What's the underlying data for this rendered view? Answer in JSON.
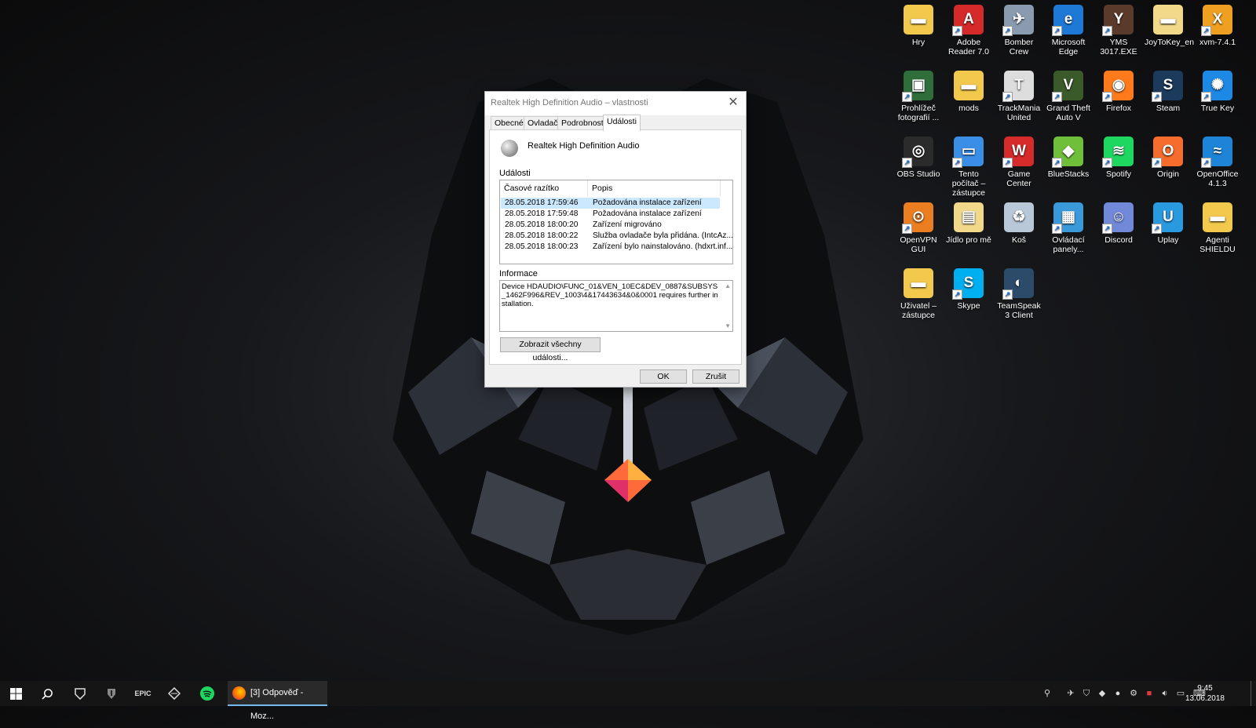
{
  "dialog": {
    "title": "Realtek High Definition Audio – vlastnosti",
    "tabs": [
      "Obecné",
      "Ovladač",
      "Podrobnosti",
      "Události"
    ],
    "active_tab": "Události",
    "device_name": "Realtek High Definition Audio",
    "events_label": "Události",
    "columns": [
      "Časové razítko",
      "Popis"
    ],
    "events": [
      {
        "time": "28.05.2018 17:59:46",
        "desc": "Požadována instalace zařízení"
      },
      {
        "time": "28.05.2018 17:59:48",
        "desc": "Požadována instalace zařízení"
      },
      {
        "time": "28.05.2018 18:00:20",
        "desc": "Zařízení migrováno"
      },
      {
        "time": "28.05.2018 18:00:22",
        "desc": "Služba ovladače byla přidána. (IntcAz..."
      },
      {
        "time": "28.05.2018 18:00:23",
        "desc": "Zařízení bylo nainstalováno. (hdxrt.inf..."
      }
    ],
    "info_label": "Informace",
    "info_text": "Device HDAUDIO\\FUNC_01&VEN_10EC&DEV_0887&SUBSYS_1462F996&REV_1003\\4&17443634&0&0001 requires further installation.",
    "show_all_button": "Zobrazit všechny události...",
    "ok_button": "OK",
    "cancel_button": "Zrušit"
  },
  "desktop_icons": [
    {
      "label": "Hry",
      "icon": "folder-icon",
      "color": "#f2c94c"
    },
    {
      "label": "Adobe Reader 7.0",
      "icon": "adobe-reader-icon",
      "color": "#d42a2a"
    },
    {
      "label": "Bomber Crew",
      "icon": "bomber-crew-icon",
      "color": "#8a9bb0"
    },
    {
      "label": "Microsoft Edge",
      "icon": "edge-icon",
      "color": "#1d78d6"
    },
    {
      "label": "YMS 3017.EXE",
      "icon": "yms-icon",
      "color": "#5a3a2a"
    },
    {
      "label": "JoyToKey_en",
      "icon": "folder-icon",
      "color": "#f2d98a"
    },
    {
      "label": "xvm-7.4.1",
      "icon": "xvm-icon",
      "color": "#f0a020"
    },
    {
      "label": "Prohlížeč fotografií ...",
      "icon": "photo-viewer-icon",
      "color": "#2f6d3a"
    },
    {
      "label": "mods",
      "icon": "folder-icon",
      "color": "#f2c94c"
    },
    {
      "label": "TrackMania United",
      "icon": "trackmania-icon",
      "color": "#dddddd"
    },
    {
      "label": "Grand Theft Auto V",
      "icon": "gta-icon",
      "color": "#3a5a2a"
    },
    {
      "label": "Firefox",
      "icon": "firefox-icon",
      "color": "#ff7a1a"
    },
    {
      "label": "Steam",
      "icon": "steam-icon",
      "color": "#1b3a5c"
    },
    {
      "label": "True Key",
      "icon": "true-key-icon",
      "color": "#1e88e5"
    },
    {
      "label": "OBS Studio",
      "icon": "obs-icon",
      "color": "#2b2b2b"
    },
    {
      "label": "Tento počítač – zástupce",
      "icon": "computer-icon",
      "color": "#3a8ee6"
    },
    {
      "label": "Game Center",
      "icon": "game-center-icon",
      "color": "#d52b2b"
    },
    {
      "label": "BlueStacks",
      "icon": "bluestacks-icon",
      "color": "#6fbf3a"
    },
    {
      "label": "Spotify",
      "icon": "spotify-icon",
      "color": "#1ed760"
    },
    {
      "label": "Origin",
      "icon": "origin-icon",
      "color": "#f56c2d"
    },
    {
      "label": "OpenOffice 4.1.3",
      "icon": "openoffice-icon",
      "color": "#1d84d8"
    },
    {
      "label": "OpenVPN GUI",
      "icon": "openvpn-icon",
      "color": "#ea7e20"
    },
    {
      "label": "Jídlo pro mě",
      "icon": "document-folder-icon",
      "color": "#f2d98a"
    },
    {
      "label": "Koš",
      "icon": "recycle-bin-icon",
      "color": "#b8c8d8"
    },
    {
      "label": "Ovládací panely...",
      "icon": "control-panel-icon",
      "color": "#3a9ad9"
    },
    {
      "label": "Discord",
      "icon": "discord-icon",
      "color": "#7289da"
    },
    {
      "label": "Uplay",
      "icon": "uplay-icon",
      "color": "#2a9ae0"
    },
    {
      "label": "Agenti SHIELDU",
      "icon": "folder-icon",
      "color": "#f2c94c"
    },
    {
      "label": "Uživatel – zástupce",
      "icon": "user-folder-icon",
      "color": "#f2c94c"
    },
    {
      "label": "Skype",
      "icon": "skype-icon",
      "color": "#00aff0"
    },
    {
      "label": "TeamSpeak 3 Client",
      "icon": "teamspeak-icon",
      "color": "#2c4a6a"
    }
  ],
  "taskbar": {
    "firefox_task": "[3] Odpověď - Moz...",
    "time": "9:45",
    "date": "13.06.2018"
  }
}
